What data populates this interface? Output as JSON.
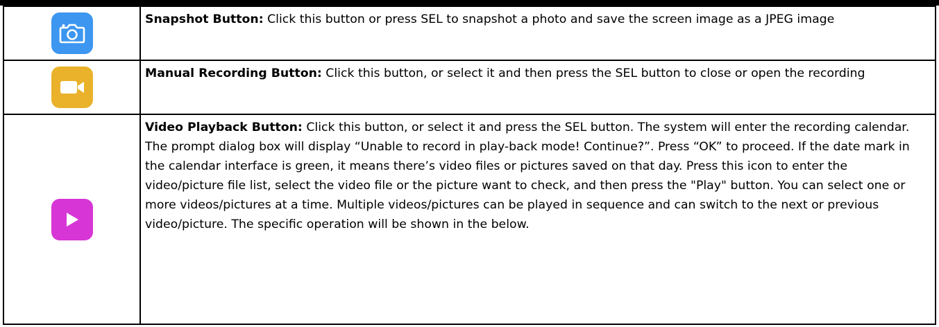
{
  "colors": {
    "snapshot_icon_bg": "#3d96f0",
    "record_icon_bg": "#eab22b",
    "playback_icon_bg": "#d735d6",
    "border": "#000000"
  },
  "rows": [
    {
      "icon": "camera-icon",
      "heading": "Snapshot Button:",
      "text": " Click this button or press SEL to snapshot a photo and save the screen image as a JPEG image"
    },
    {
      "icon": "video-camera-icon",
      "heading": "Manual Recording Button:",
      "text": " Click this button, or select it and then press the SEL button to close or open the recording"
    },
    {
      "icon": "play-icon",
      "heading": "Video Playback Button:",
      "text": " Click this button, or select it and press the SEL button. The system will enter the recording calendar. The prompt dialog box will display “Unable to record in play-back mode! Continue?”. Press “OK” to proceed. If the date mark in the calendar interface is green, it means there’s video files or pictures saved on that day. Press this icon to enter the video/picture file list, select the video file or the picture want to check, and then press the \"Play\" button. You can select one or more videos/pictures at a time. Multiple videos/pictures can be played in sequence and can switch to the next or previous video/picture. The specific operation will be shown in the below."
    }
  ]
}
